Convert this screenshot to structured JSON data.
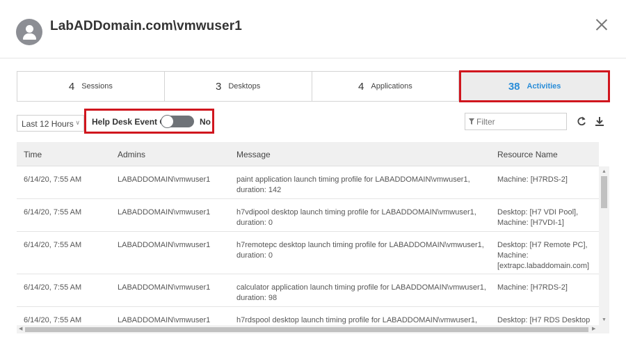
{
  "header": {
    "title": "LabADDomain.com\\vmwuser1",
    "avatar_icon": "user-avatar-icon",
    "close_icon": "close-icon"
  },
  "tabs": [
    {
      "count": "4",
      "label": "Sessions",
      "active": false
    },
    {
      "count": "3",
      "label": "Desktops",
      "active": false
    },
    {
      "count": "4",
      "label": "Applications",
      "active": false
    },
    {
      "count": "38",
      "label": "Activities",
      "active": true
    }
  ],
  "toolbar": {
    "range_value": "Last 12 Hours",
    "helpdesk_label": "Help Desk Event Only",
    "helpdesk_value": "No",
    "filter_placeholder": "Filter",
    "refresh_icon": "refresh-icon",
    "download_icon": "download-icon"
  },
  "table": {
    "columns": [
      "Time",
      "Admins",
      "Message",
      "Resource Name"
    ],
    "rows": [
      {
        "time": "6/14/20, 7:55 AM",
        "admin": "LABADDOMAIN\\vmwuser1",
        "message": "paint application launch timing profile for LABADDOMAIN\\vmwuser1, duration: 142",
        "resource": "Machine: [H7RDS-2]"
      },
      {
        "time": "6/14/20, 7:55 AM",
        "admin": "LABADDOMAIN\\vmwuser1",
        "message": "h7vdipool desktop launch timing profile for LABADDOMAIN\\vmwuser1, duration: 0",
        "resource": "Desktop: [H7 VDI Pool], Machine: [H7VDI-1]"
      },
      {
        "time": "6/14/20, 7:55 AM",
        "admin": "LABADDOMAIN\\vmwuser1",
        "message": "h7remotepc desktop launch timing profile for LABADDOMAIN\\vmwuser1, duration: 0",
        "resource": "Desktop: [H7 Remote PC], Machine: [extrapc.labaddomain.com]"
      },
      {
        "time": "6/14/20, 7:55 AM",
        "admin": "LABADDOMAIN\\vmwuser1",
        "message": "calculator application launch timing profile for LABADDOMAIN\\vmwuser1, duration: 98",
        "resource": "Machine: [H7RDS-2]"
      },
      {
        "time": "6/14/20, 7:55 AM",
        "admin": "LABADDOMAIN\\vmwuser1",
        "message": "h7rdspool desktop launch timing profile for LABADDOMAIN\\vmwuser1,",
        "resource": "Desktop: [H7 RDS Desktop"
      }
    ]
  },
  "colors": {
    "accent": "#2a8dd8",
    "highlight_border": "#d0161e",
    "toggle_off": "#6f7378"
  }
}
